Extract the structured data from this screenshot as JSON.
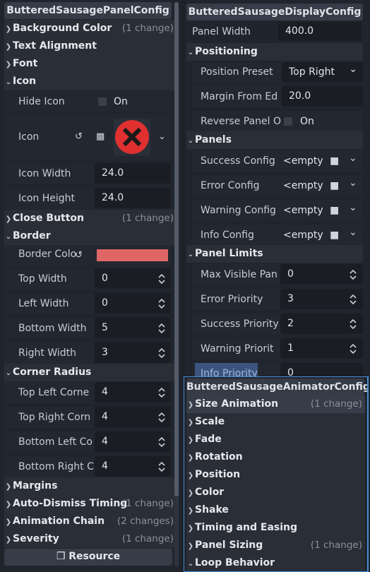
{
  "panel_config": {
    "title": "ButteredSausagePanelConfig",
    "background_color": {
      "label": "Background Color",
      "changes": "(1 change)"
    },
    "text_alignment": {
      "label": "Text Alignment"
    },
    "font": {
      "label": "Font"
    },
    "icon_section": {
      "label": "Icon"
    },
    "hide_icon": {
      "label": "Hide Icon",
      "value": "On"
    },
    "icon": {
      "label": "Icon"
    },
    "icon_width": {
      "label": "Icon Width",
      "value": "24.0"
    },
    "icon_height": {
      "label": "Icon Height",
      "value": "24.0"
    },
    "close_button": {
      "label": "Close Button",
      "changes": "(1 change)"
    },
    "border_section": {
      "label": "Border"
    },
    "border_color": {
      "label": "Border Colo",
      "color": "#e06666"
    },
    "top_width": {
      "label": "Top Width",
      "value": "0"
    },
    "left_width": {
      "label": "Left Width",
      "value": "0"
    },
    "bottom_width": {
      "label": "Bottom Width",
      "value": "5"
    },
    "right_width": {
      "label": "Right Width",
      "value": "3"
    },
    "corner_radius": {
      "label": "Corner Radius"
    },
    "top_left": {
      "label": "Top Left Corne",
      "value": "4"
    },
    "top_right": {
      "label": "Top Right Corn",
      "value": "4"
    },
    "bottom_left": {
      "label": "Bottom Left Co",
      "value": "4"
    },
    "bottom_right": {
      "label": "Bottom Right C",
      "value": "4"
    },
    "margins": {
      "label": "Margins"
    },
    "auto_dismiss": {
      "label": "Auto-Dismiss Timing",
      "changes": "(1 change)"
    },
    "animation_chain": {
      "label": "Animation Chain",
      "changes": "(2 changes)"
    },
    "severity": {
      "label": "Severity",
      "changes": "(1 change)"
    },
    "resource_button": "Resource"
  },
  "display_config": {
    "title": "ButteredSausageDisplayConfig",
    "panel_width": {
      "label": "Panel Width",
      "value": "400.0"
    },
    "positioning": {
      "label": "Positioning"
    },
    "position_preset": {
      "label": "Position Preset",
      "value": "Top Right"
    },
    "margin_from_edge": {
      "label": "Margin From Ed",
      "value": "20.0"
    },
    "reverse_panel": {
      "label": "Reverse Panel O",
      "value": "On"
    },
    "panels": {
      "label": "Panels"
    },
    "success_config": {
      "label": "Success Config",
      "value": "<empty"
    },
    "error_config": {
      "label": "Error Config",
      "value": "<empty"
    },
    "warning_config": {
      "label": "Warning Config",
      "value": "<empty"
    },
    "info_config": {
      "label": "Info Config",
      "value": "<empty"
    },
    "panel_limits": {
      "label": "Panel Limits"
    },
    "max_visible": {
      "label": "Max Visible Pan",
      "value": "0"
    },
    "error_priority": {
      "label": "Error Priority",
      "value": "3"
    },
    "success_priority": {
      "label": "Success Priority",
      "value": "2"
    },
    "warning_priority": {
      "label": "Warning Priorit",
      "value": "1"
    },
    "info_priority": {
      "label": "Info Priority",
      "value": "0"
    }
  },
  "animator_config": {
    "title": "ButteredSausageAnimatorConfig",
    "size_animation": {
      "label": "Size Animation",
      "changes": "(1 change)"
    },
    "scale": {
      "label": "Scale"
    },
    "fade": {
      "label": "Fade"
    },
    "rotation": {
      "label": "Rotation"
    },
    "position": {
      "label": "Position"
    },
    "color": {
      "label": "Color"
    },
    "shake": {
      "label": "Shake"
    },
    "timing_easing": {
      "label": "Timing and Easing"
    },
    "panel_sizing": {
      "label": "Panel Sizing",
      "changes": "(1 change)"
    },
    "loop_behavior": {
      "label": "Loop Behavior"
    }
  },
  "colors": {
    "accent": "#4a8fd8",
    "border_swatch": "#e06666",
    "icon_red": "#e03030"
  }
}
